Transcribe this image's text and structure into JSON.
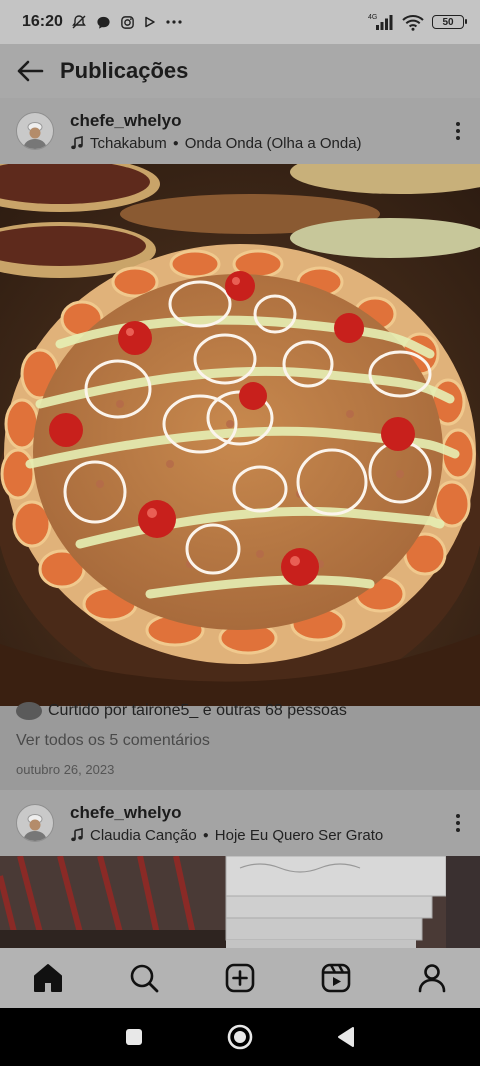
{
  "status_bar": {
    "time": "16:20",
    "network": "4G",
    "battery": "50",
    "icons": [
      "mute-icon",
      "chat-bubble-icon",
      "instagram-icon",
      "play-icon",
      "more-dots-icon",
      "signal-icon",
      "wifi-icon",
      "battery-icon"
    ]
  },
  "header": {
    "back_icon": "arrow-left-icon",
    "title": "Publicações"
  },
  "posts": [
    {
      "username": "chefe_whelyo",
      "music_artist": "Tchakabum",
      "music_title": "Onda Onda (Olha a Onda)",
      "likes_text": "Curtido por tairone5_ e outras 68 pessoas",
      "comments_text": "Ver todos os 5 comentários",
      "date": "outubro 26, 2023"
    },
    {
      "username": "chefe_whelyo",
      "music_artist": "Claudia Canção",
      "music_title": "Hoje Eu Quero Ser Grato"
    }
  ],
  "bottom_nav": [
    "home-icon",
    "search-icon",
    "create-post-icon",
    "reels-icon",
    "profile-icon"
  ],
  "system_nav": [
    "recents-button",
    "home-button",
    "back-button"
  ],
  "colors": {
    "overlay_gray": "#a9a9a9",
    "pizza_crust": "#d68a4a",
    "tomato": "#c8201c"
  }
}
